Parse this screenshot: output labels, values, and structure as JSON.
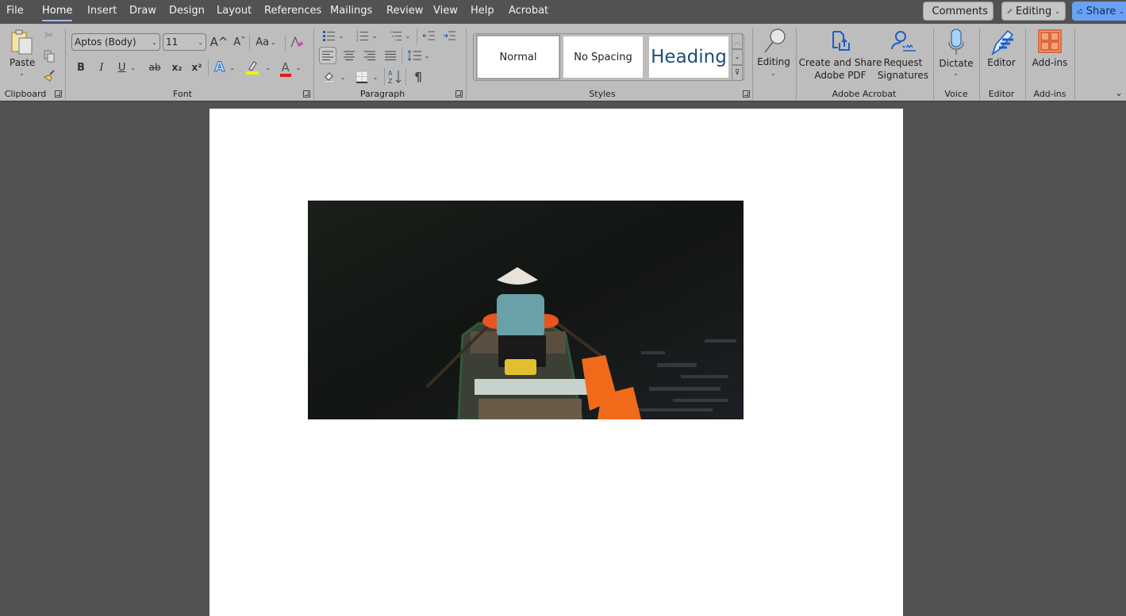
{
  "menubar": {
    "tabs": [
      {
        "label": "File"
      },
      {
        "label": "Home",
        "active": true
      },
      {
        "label": "Insert"
      },
      {
        "label": "Draw"
      },
      {
        "label": "Design"
      },
      {
        "label": "Layout"
      },
      {
        "label": "References"
      },
      {
        "label": "Mailings"
      },
      {
        "label": "Review"
      },
      {
        "label": "View"
      },
      {
        "label": "Help"
      },
      {
        "label": "Acrobat"
      }
    ],
    "comments_label": "Comments",
    "editing_label": "Editing",
    "share_label": "Share"
  },
  "ribbon": {
    "clipboard": {
      "label": "Clipboard",
      "paste_label": "Paste",
      "icons": [
        "cut-icon",
        "copy-icon",
        "format-painter-icon"
      ]
    },
    "font": {
      "label": "Font",
      "font_name": "Aptos (Body)",
      "font_size": "11",
      "grow_glyph": "A^",
      "shrink_glyph": "Aˇ",
      "change_case_glyph": "Aa",
      "bold_glyph": "B",
      "italic_glyph": "I",
      "underline_glyph": "U",
      "strike_glyph": "ab",
      "subscript_glyph": "x₂",
      "superscript_glyph": "x²",
      "text_effects_glyph": "A",
      "font_color_glyph": "A",
      "highlight_color": "#f5f20a",
      "font_color": "#e01b1b"
    },
    "paragraph": {
      "label": "Paragraph",
      "pilcrow_glyph": "¶",
      "sort_glyph": "A Z"
    },
    "styles": {
      "label": "Styles",
      "items": [
        {
          "label": "Normal"
        },
        {
          "label": "No Spacing"
        },
        {
          "label": "Heading"
        }
      ],
      "heading_color": "#1e4e79"
    },
    "editing": {
      "label": "Editing"
    },
    "adobe_acrobat": {
      "label": "Adobe Acrobat",
      "create_share_line1": "Create and Share",
      "create_share_line2": "Adobe PDF",
      "request_line1": "Request",
      "request_line2": "Signatures"
    },
    "voice": {
      "label": "Voice",
      "dictate_label": "Dictate"
    },
    "editor": {
      "label": "Editor",
      "button_label": "Editor"
    },
    "addins": {
      "label": "Add-ins",
      "button_label": "Add-ins",
      "icon_color": "#e2673a"
    }
  },
  "document": {
    "image_description": "Person in conical hat seated in a rowboat on dark water with orange life vests"
  }
}
